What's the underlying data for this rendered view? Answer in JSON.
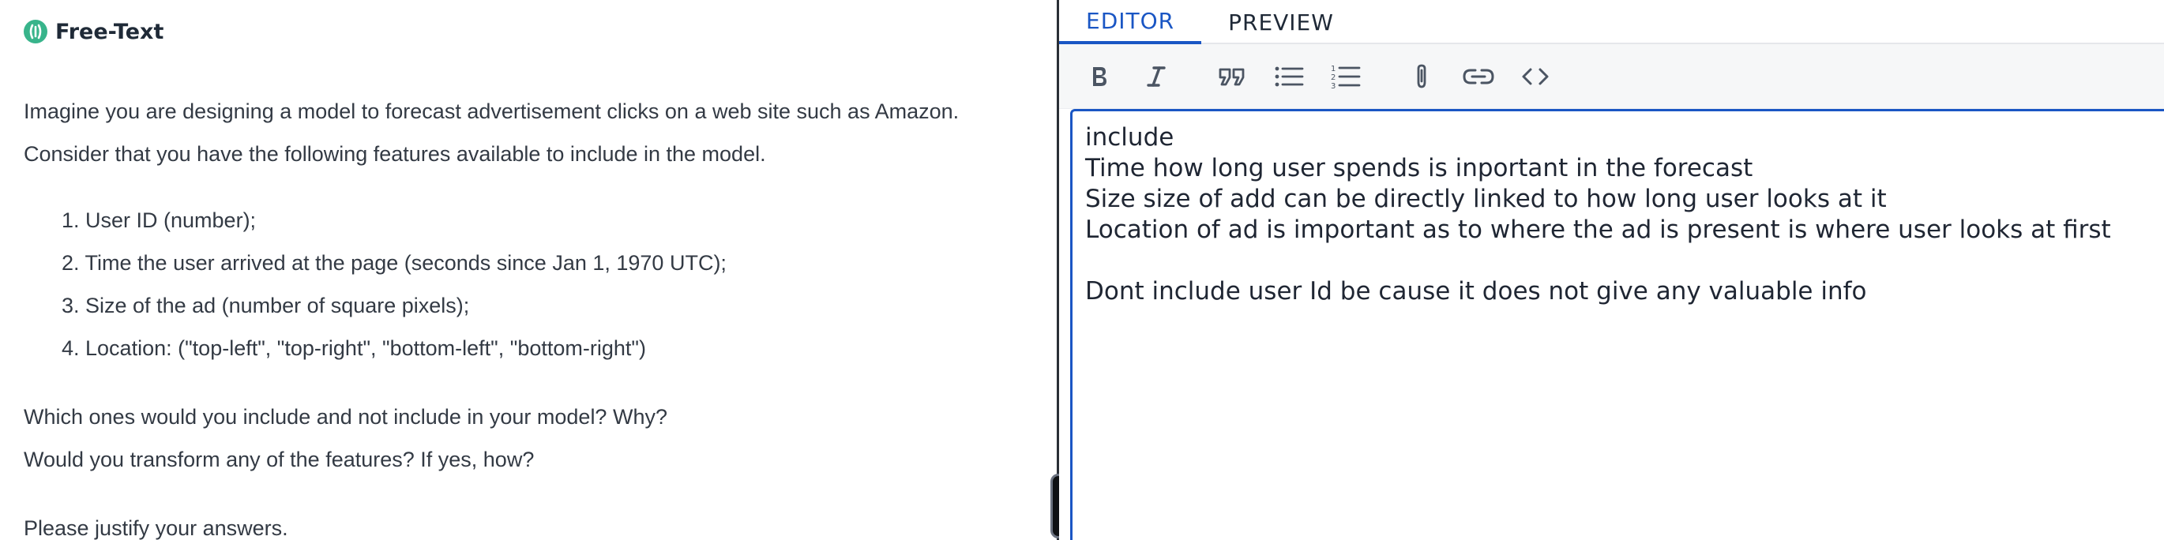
{
  "question": {
    "type_label": "Free-Text",
    "intro_line_1": "Imagine you are designing a model to forecast advertisement clicks on a web site such as Amazon.",
    "intro_line_2": "Consider that you have the following features available to include in the model.",
    "features": [
      "1. User ID (number);",
      "2. Time the user arrived at the page (seconds since Jan 1, 1970 UTC);",
      "3. Size of the ad (number of square pixels);",
      "4. Location: (\"top-left\", \"top-right\", \"bottom-left\", \"bottom-right\")"
    ],
    "ask_line_1": "Which ones would you include and not include in your model? Why?",
    "ask_line_2": "Would you transform any of the features? If yes, how?",
    "justify": "Please justify your answers."
  },
  "editor": {
    "tabs": [
      {
        "label": "EDITOR",
        "active": true
      },
      {
        "label": "PREVIEW",
        "active": false
      }
    ],
    "toolbar": [
      {
        "icon": "bold-icon"
      },
      {
        "icon": "italic-icon"
      },
      {
        "icon": "quote-icon"
      },
      {
        "icon": "bullet-list-icon"
      },
      {
        "icon": "numbered-list-icon"
      },
      {
        "icon": "attachment-icon"
      },
      {
        "icon": "link-icon"
      },
      {
        "icon": "code-icon"
      }
    ],
    "lines": [
      "include",
      "Time how long user spends is inportant in the forecast",
      "Size size of add can be directly linked to how long user looks at it",
      "Location of ad is important as to where the ad is present is where user looks at first",
      "",
      "Dont include user Id be cause it does not give any valuable info"
    ]
  },
  "colors": {
    "accent": "#1a56c4",
    "type_icon": "#38b48b"
  }
}
